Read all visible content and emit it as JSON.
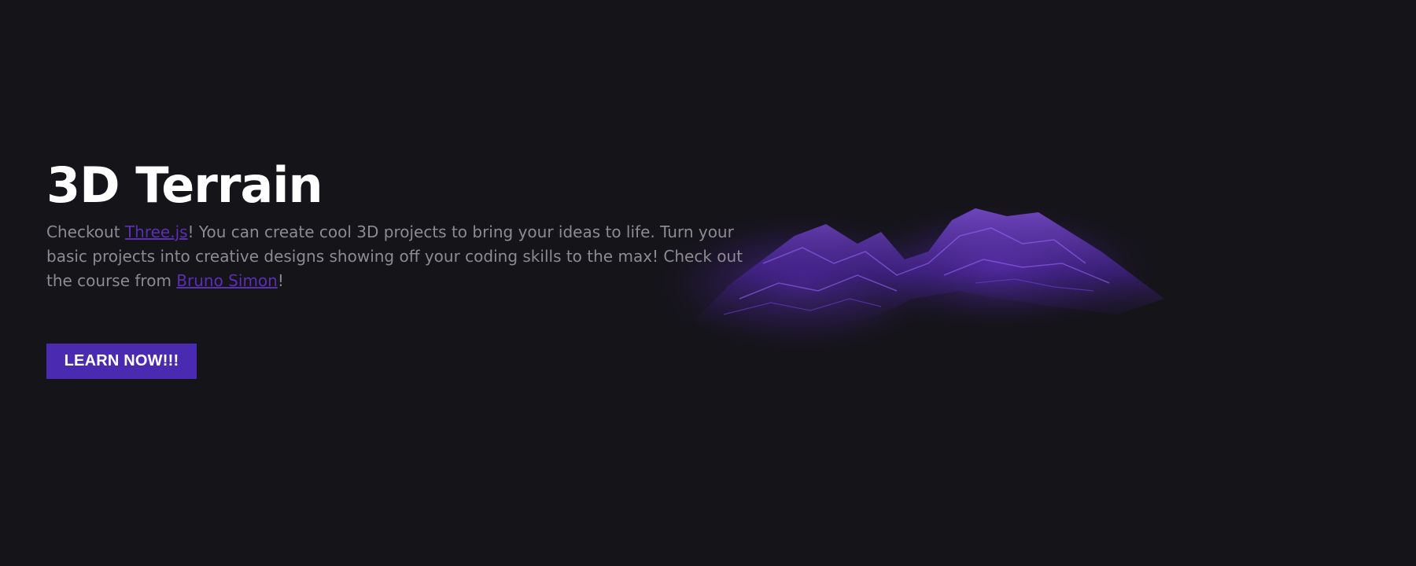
{
  "hero": {
    "title": "3D Terrain",
    "desc_before_link1": "Checkout ",
    "link1_label": "Three.js",
    "desc_middle": "! You can create cool 3D projects to bring your ideas to life. Turn your basic projects into creative designs showing off your coding skills to the max! Check out the course from ",
    "link2_label": "Bruno Simon",
    "desc_end": "!",
    "button_label": "LEARN NOW!!!"
  },
  "colors": {
    "background": "#151419",
    "accent": "#4a2ab0",
    "link": "#5a2fb5",
    "body_text": "#8d8a94",
    "terrain": "#6a35d0"
  },
  "terrain": {
    "icon": "terrain-visual"
  }
}
